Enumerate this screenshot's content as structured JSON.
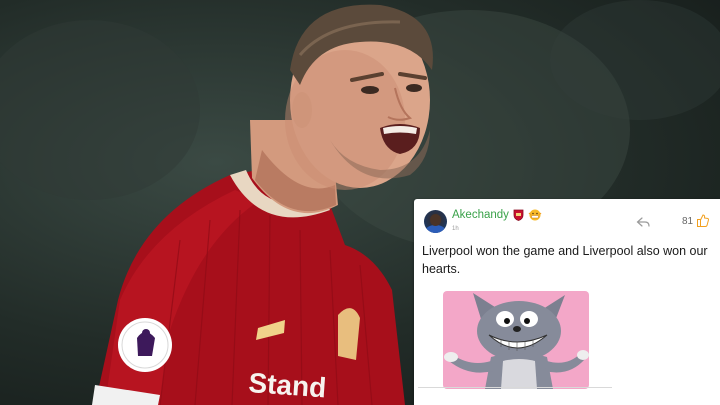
{
  "photo": {
    "kit_sponsor": "Stand"
  },
  "comment": {
    "username": "Akechandy",
    "time": "1h",
    "text": "Liverpool won the game and Liverpool also won our hearts.",
    "likes": "81",
    "icons": {
      "reply": "reply-arrow-icon",
      "like": "thumbs-up-icon",
      "club_badge": "club-shield-icon",
      "emoji": "grimace-emoji-icon"
    },
    "image": "cartoon-cat-grin-meme"
  },
  "colors": {
    "username": "#3aa24a",
    "like_thumb": "#f2a01f",
    "meme_bg": "#f3a7c8",
    "kit_red": "#b3101c"
  }
}
